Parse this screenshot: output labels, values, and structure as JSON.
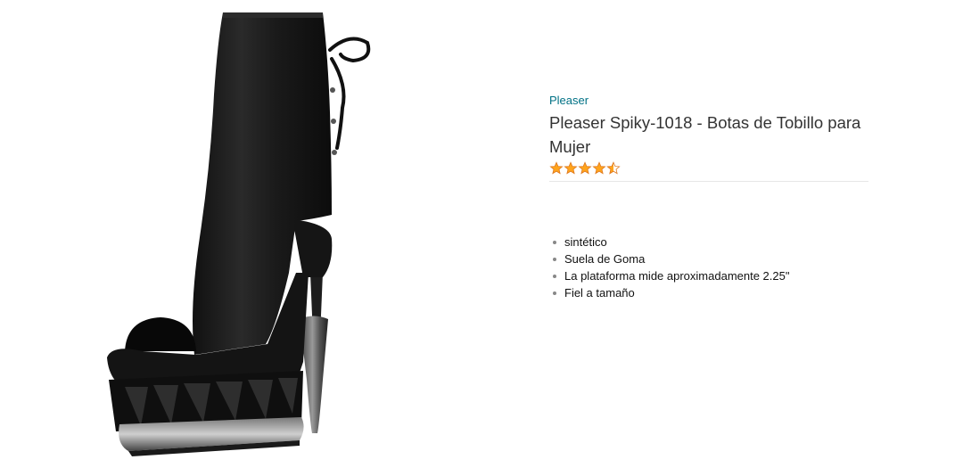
{
  "product": {
    "brand": "Pleaser",
    "title": "Pleaser Spiky-1018 - Botas de Tobillo para Mujer",
    "rating": 4.5,
    "features": [
      "sintético",
      "Suela de Goma",
      "La plataforma mide aproximadamente 2.25\"",
      "Fiel a tamaño"
    ]
  },
  "colors": {
    "brand_link": "#007185",
    "star_fill": "#ffa41c",
    "star_stroke": "#de7921",
    "boot": "#1c1c1c"
  },
  "icons": {
    "product_image": "black-ankle-boot-photo",
    "rating": "star-rating-icon"
  }
}
